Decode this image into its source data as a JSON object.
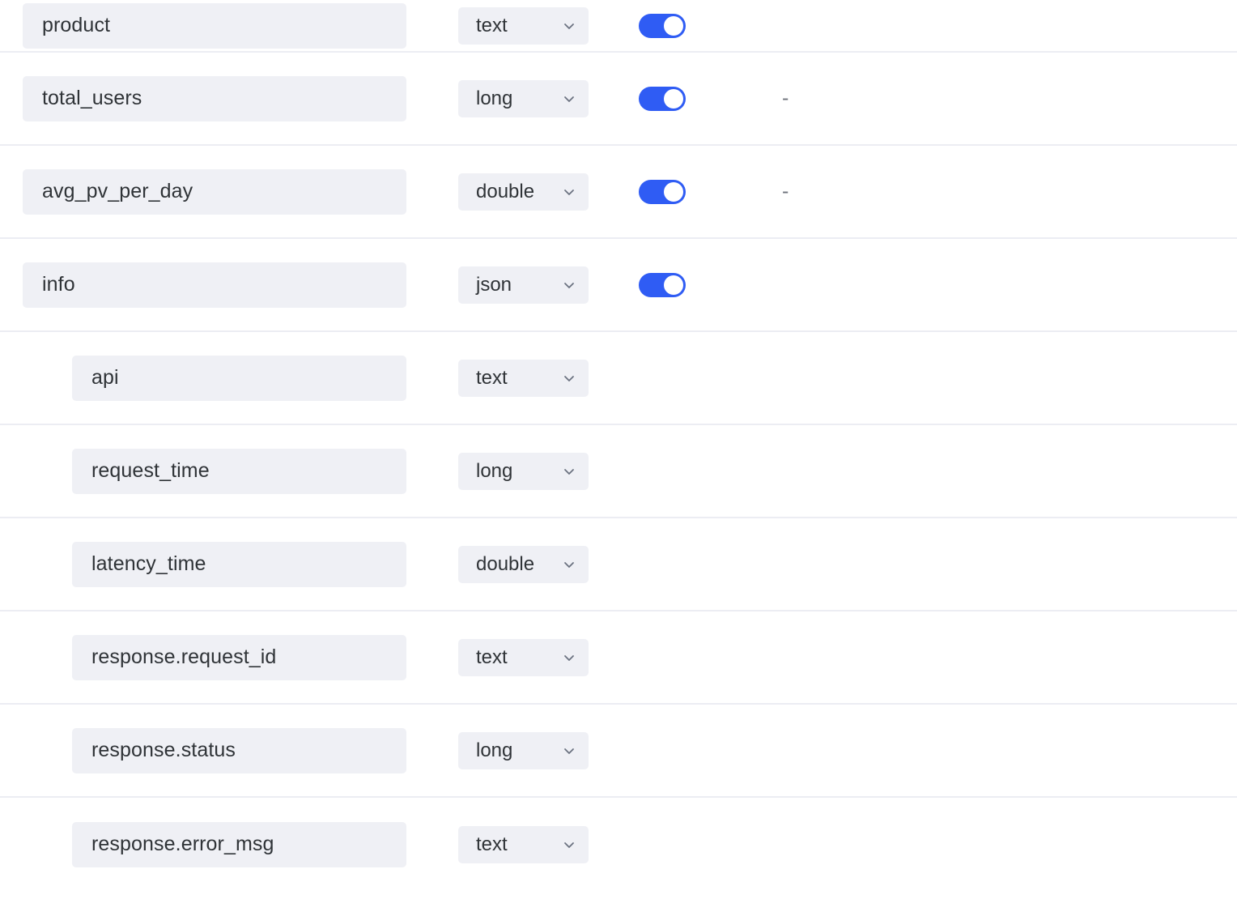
{
  "theme": {
    "accent": "#2f5cf4",
    "field_bg": "#eff0f5",
    "divider": "#ecedf3",
    "text": "#2f3337",
    "muted_text": "#6f737c",
    "page_bg": "#ffffff"
  },
  "icons": {
    "chevron_down": "chevron-down-icon"
  },
  "schema": {
    "rows": [
      {
        "name": "product",
        "type": "text",
        "level": 0,
        "toggle": true,
        "extra": ""
      },
      {
        "name": "total_users",
        "type": "long",
        "level": 0,
        "toggle": true,
        "extra": "-"
      },
      {
        "name": "avg_pv_per_day",
        "type": "double",
        "level": 0,
        "toggle": true,
        "extra": "-"
      },
      {
        "name": "info",
        "type": "json",
        "level": 0,
        "toggle": true,
        "extra": ""
      },
      {
        "name": "api",
        "type": "text",
        "level": 1,
        "toggle": null,
        "extra": ""
      },
      {
        "name": "request_time",
        "type": "long",
        "level": 1,
        "toggle": null,
        "extra": ""
      },
      {
        "name": "latency_time",
        "type": "double",
        "level": 1,
        "toggle": null,
        "extra": ""
      },
      {
        "name": "response.request_id",
        "type": "text",
        "level": 1,
        "toggle": null,
        "extra": ""
      },
      {
        "name": "response.status",
        "type": "long",
        "level": 1,
        "toggle": null,
        "extra": ""
      },
      {
        "name": "response.error_msg",
        "type": "text",
        "level": 1,
        "toggle": null,
        "extra": ""
      }
    ]
  }
}
